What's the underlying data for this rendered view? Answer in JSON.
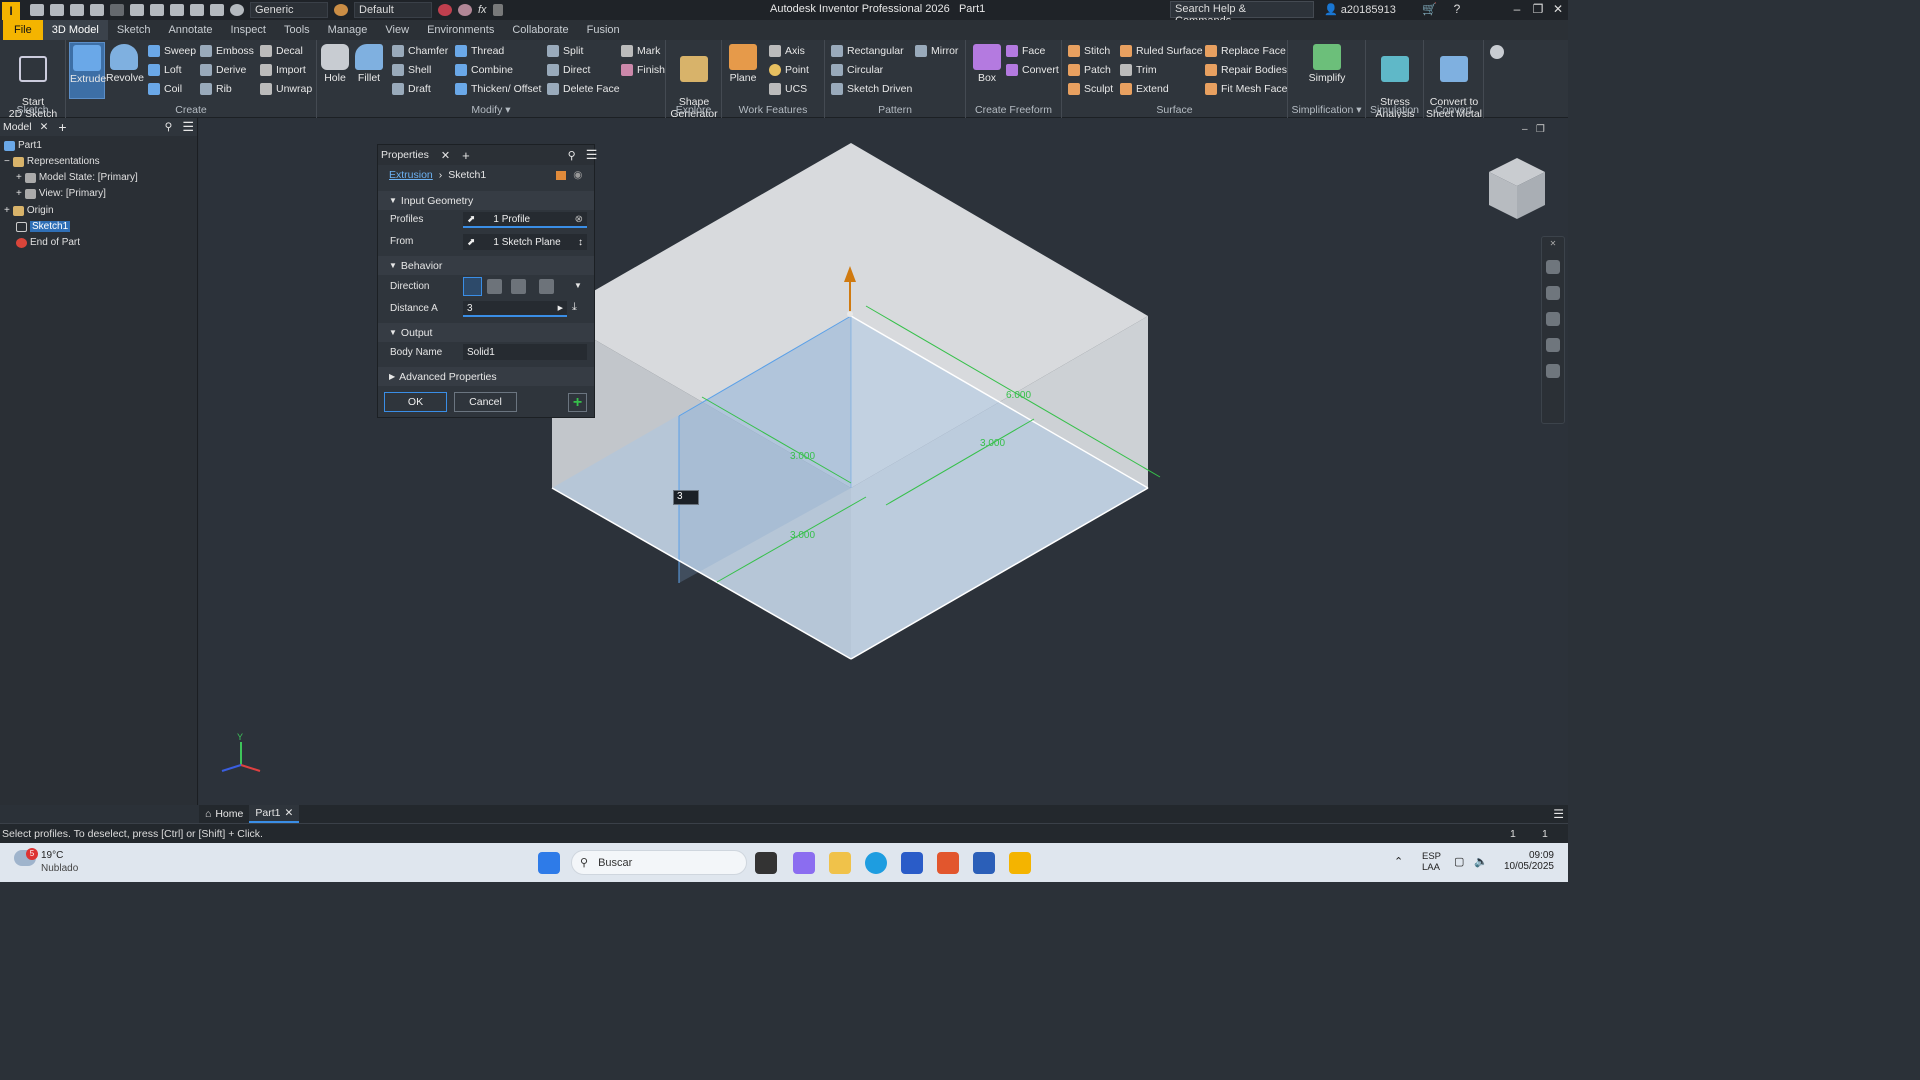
{
  "titlebar": {
    "app_title": "Autodesk Inventor Professional 2026",
    "document": "Part1",
    "logo": "I",
    "appearance": "Generic",
    "material": "Default",
    "search_placeholder": "Search Help & Commands...",
    "user": "a20185913"
  },
  "menu_tabs": [
    "File",
    "3D Model",
    "Sketch",
    "Annotate",
    "Inspect",
    "Tools",
    "Manage",
    "View",
    "Environments",
    "Collaborate",
    "Fusion"
  ],
  "ribbon": {
    "panels": {
      "sketch": "Sketch",
      "create": "Create",
      "modify": "Modify",
      "explore": "Explore",
      "work_features": "Work Features",
      "pattern": "Pattern",
      "create_freeform": "Create Freeform",
      "surface": "Surface",
      "simplification": "Simplification",
      "simulation": "Simulation",
      "convert": "Convert"
    },
    "start_2d_sketch": "Start\n2D Sketch",
    "extrude": "Extrude",
    "revolve": "Revolve",
    "sweep": "Sweep",
    "loft": "Loft",
    "coil": "Coil",
    "emboss": "Emboss",
    "derive": "Derive",
    "rib": "Rib",
    "decal": "Decal",
    "import": "Import",
    "unwrap": "Unwrap",
    "hole": "Hole",
    "fillet": "Fillet",
    "chamfer": "Chamfer",
    "shell": "Shell",
    "draft": "Draft",
    "thread": "Thread",
    "combine": "Combine",
    "thicken": "Thicken/ Offset",
    "split": "Split",
    "direct": "Direct",
    "delete_face": "Delete Face",
    "mark": "Mark",
    "finish": "Finish",
    "shape_generator": "Shape\nGenerator",
    "plane": "Plane",
    "axis": "Axis",
    "point": "Point",
    "ucs": "UCS",
    "rectangular": "Rectangular",
    "circular": "Circular",
    "sketch_driven": "Sketch Driven",
    "mirror": "Mirror",
    "box": "Box",
    "face": "Face",
    "convert": "Convert",
    "stitch": "Stitch",
    "patch": "Patch",
    "sculpt": "Sculpt",
    "ruled_surface": "Ruled Surface",
    "trim": "Trim",
    "extend": "Extend",
    "replace_face": "Replace Face",
    "repair_bodies": "Repair Bodies",
    "fit_mesh_face": "Fit Mesh Face",
    "simplify": "Simplify",
    "stress_analysis": "Stress\nAnalysis",
    "convert_sheet_metal": "Convert to\nSheet Metal"
  },
  "browser": {
    "tab": "Model",
    "items": [
      {
        "label": "Part1"
      },
      {
        "label": "Representations"
      },
      {
        "label": "Model State: [Primary]"
      },
      {
        "label": "View: [Primary]"
      },
      {
        "label": "Origin"
      },
      {
        "label": "Sketch1"
      },
      {
        "label": "End of Part"
      }
    ]
  },
  "properties": {
    "title": "Properties",
    "breadcrumb_feature": "Extrusion",
    "breadcrumb_sketch": "Sketch1",
    "input_geometry": "Input Geometry",
    "profiles_label": "Profiles",
    "profiles_value": "1 Profile",
    "from_label": "From",
    "from_value": "1 Sketch Plane",
    "behavior": "Behavior",
    "direction_label": "Direction",
    "distance_label": "Distance A",
    "distance_value": "3",
    "output": "Output",
    "body_name_label": "Body Name",
    "body_name_value": "Solid1",
    "advanced": "Advanced Properties",
    "ok": "OK",
    "cancel": "Cancel"
  },
  "viewport": {
    "dimensions": [
      "6.000",
      "3.000",
      "3.000",
      "3.000"
    ],
    "input_value": "3",
    "axis_y": "Y"
  },
  "doc_tabs": [
    "Home",
    "Part1"
  ],
  "status": {
    "message": "Select profiles. To deselect, press [Ctrl] or [Shift] + Click.",
    "count1": "1",
    "count2": "1"
  },
  "taskbar": {
    "weather_temp": "19°C",
    "weather_desc": "Nublado",
    "weather_badge": "5",
    "search_placeholder": "Buscar",
    "lang1": "ESP",
    "lang2": "LAA",
    "time": "09:09",
    "date": "10/05/2025"
  }
}
